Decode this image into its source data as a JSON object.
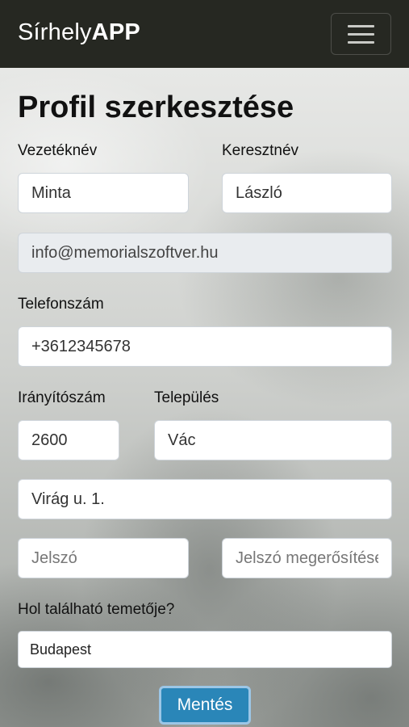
{
  "navbar": {
    "brand_prefix": "Sírhely",
    "brand_suffix": "APP",
    "menu_icon": "hamburger-menu-icon"
  },
  "page": {
    "title": "Profil szerkesztése"
  },
  "form": {
    "last_name_label": "Vezetéknév",
    "last_name_value": "Minta",
    "first_name_label": "Keresztnév",
    "first_name_value": "László",
    "email_value": "info@memorialszoftver.hu",
    "phone_label": "Telefonszám",
    "phone_value": "+3612345678",
    "zip_label": "Irányítószám",
    "zip_value": "2600",
    "city_label": "Település",
    "city_value": "Vác",
    "address_value": "Virág u. 1.",
    "password_placeholder": "Jelszó",
    "password_confirm_placeholder": "Jelszó megerősítése",
    "cemetery_label": "Hol található temetője?",
    "cemetery_selected": "Budapest",
    "save_label": "Mentés"
  }
}
